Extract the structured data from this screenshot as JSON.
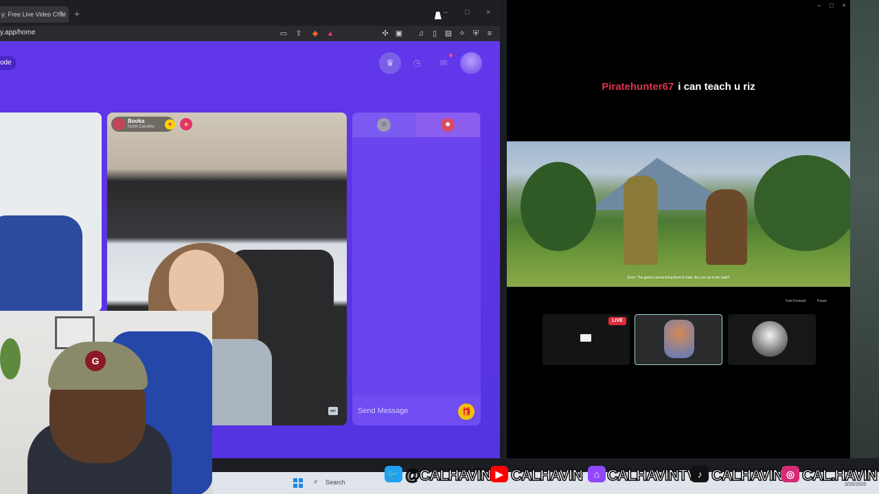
{
  "browser": {
    "tab_title": "y: Free Live Video Chat",
    "tab_close": "×",
    "new_tab": "+",
    "url": "y.app/home",
    "window_controls": {
      "minimize": "–",
      "maximize": "□",
      "close": "×"
    },
    "toolbar_icons": [
      "cast-icon",
      "screenshot-icon",
      "share-icon",
      "shield-brave-icon",
      "rewards-icon",
      "extensions-icon",
      "tabs-icon",
      "music-icon",
      "sidebar-icon",
      "wallet-icon",
      "leo-icon",
      "vpn-icon",
      "menu-icon"
    ]
  },
  "site": {
    "mode_label": "ode",
    "accent": "#5b37e6",
    "video": {
      "user_name": "Booka",
      "user_location": "North Carolina",
      "heart": "♥",
      "skip": "⏭"
    },
    "chat": {
      "placeholder": "Send Message",
      "gift": "🎁"
    }
  },
  "stream_overlay": {
    "chat_name": "Piratehunter67",
    "chat_message": "i can teach u riz",
    "name_color": "#e0334f",
    "game_subtitle": "Erich: The guard cannot bring them to heel. Are you up to the task?",
    "controls": {
      "fast_forward": "Fast Forward",
      "pause": "Pause"
    },
    "live_badge": "LIVE"
  },
  "social": [
    {
      "platform": "twitter",
      "icon": "🐦",
      "handle": "@CALHAVIN",
      "color": "#1da1f2"
    },
    {
      "platform": "youtube",
      "icon": "▶",
      "handle": "CALHAVIN",
      "color": "#ff0000"
    },
    {
      "platform": "twitch",
      "icon": "⌂",
      "handle": "CALHAVINTV",
      "color": "#9146ff"
    },
    {
      "platform": "tiktok",
      "icon": "♪",
      "handle": "CALHAVIN",
      "color": "#000000"
    },
    {
      "platform": "instagram",
      "icon": "◎",
      "handle": "CAL.HAVIN",
      "color": "#d62976"
    }
  ],
  "taskbar": {
    "search_label": "Search",
    "date": "3/20/2026"
  }
}
